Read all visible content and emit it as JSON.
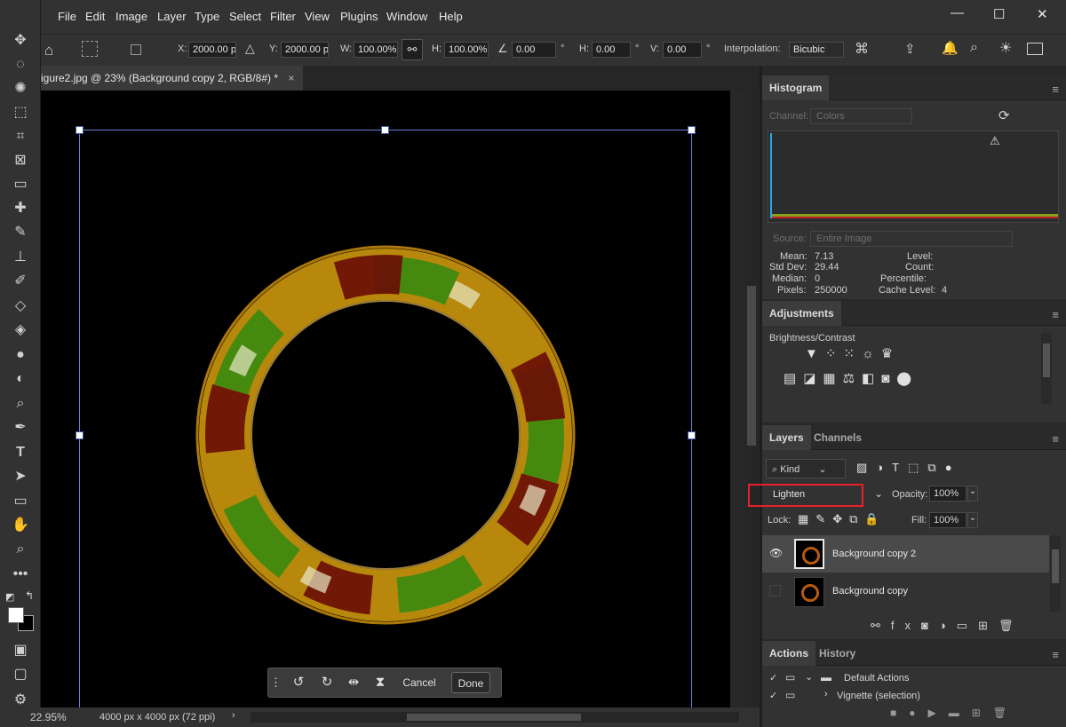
{
  "menubar": {
    "items": [
      "File",
      "Edit",
      "Image",
      "Layer",
      "Type",
      "Select",
      "Filter",
      "View",
      "Plugins",
      "Window",
      "Help"
    ],
    "window_controls": {
      "minimize": "—",
      "maximize": "☐",
      "close": "✕"
    }
  },
  "options": {
    "x_label": "X:",
    "x_value": "2000.00 p",
    "y_label": "Y:",
    "y_value": "2000.00 p",
    "w_label": "W:",
    "w_value": "100.00%",
    "h_label": "H:",
    "h_value": "100.00%",
    "angle_value": "0.00",
    "angle_unit": "°",
    "hskew_label": "H:",
    "hskew_value": "0.00",
    "hskew_unit": "°",
    "vskew_label": "V:",
    "vskew_value": "0.00",
    "vskew_unit": "°",
    "interp_label": "Interpolation:",
    "interp_value": "Bicubic"
  },
  "document": {
    "tab_title": "igure2.jpg @ 23% (Background copy 2, RGB/8#) *",
    "close": "×"
  },
  "status": {
    "zoom": "22.95%",
    "dims": "4000 px x 4000 px (72 ppi)",
    "arrow": "›"
  },
  "transform_bar": {
    "cancel": "Cancel",
    "done": "Done"
  },
  "histogram": {
    "tab": "Histogram",
    "channel_label": "Channel:",
    "channel_value": "Colors",
    "source_label": "Source:",
    "source_value": "Entire Image",
    "mean_label": "Mean:",
    "mean_value": "7.13",
    "stddev_label": "Std Dev:",
    "stddev_value": "29.44",
    "median_label": "Median:",
    "median_value": "0",
    "pixels_label": "Pixels:",
    "pixels_value": "250000",
    "level_label": "Level:",
    "count_label": "Count:",
    "percentile_label": "Percentile:",
    "cache_label": "Cache Level:",
    "cache_value": "4"
  },
  "adjustments": {
    "tab": "Adjustments",
    "hover_label": "Brightness/Contrast"
  },
  "layers": {
    "tab": "Layers",
    "tab2": "Channels",
    "kind_label": "Kind",
    "blend_mode": "Lighten",
    "opacity_label": "Opacity:",
    "opacity_value": "100%",
    "lock_label": "Lock:",
    "fill_label": "Fill:",
    "fill_value": "100%",
    "items": [
      {
        "name": "Background copy 2",
        "visible": true,
        "selected": true
      },
      {
        "name": "Background copy",
        "visible": false,
        "selected": false
      }
    ]
  },
  "actions": {
    "tab": "Actions",
    "tab2": "History",
    "items": [
      "Default Actions",
      "Vignette (selection)"
    ]
  },
  "colors": {
    "accent": "#e8202a",
    "selection": "#4a4a4a",
    "canvas": "#000000"
  }
}
